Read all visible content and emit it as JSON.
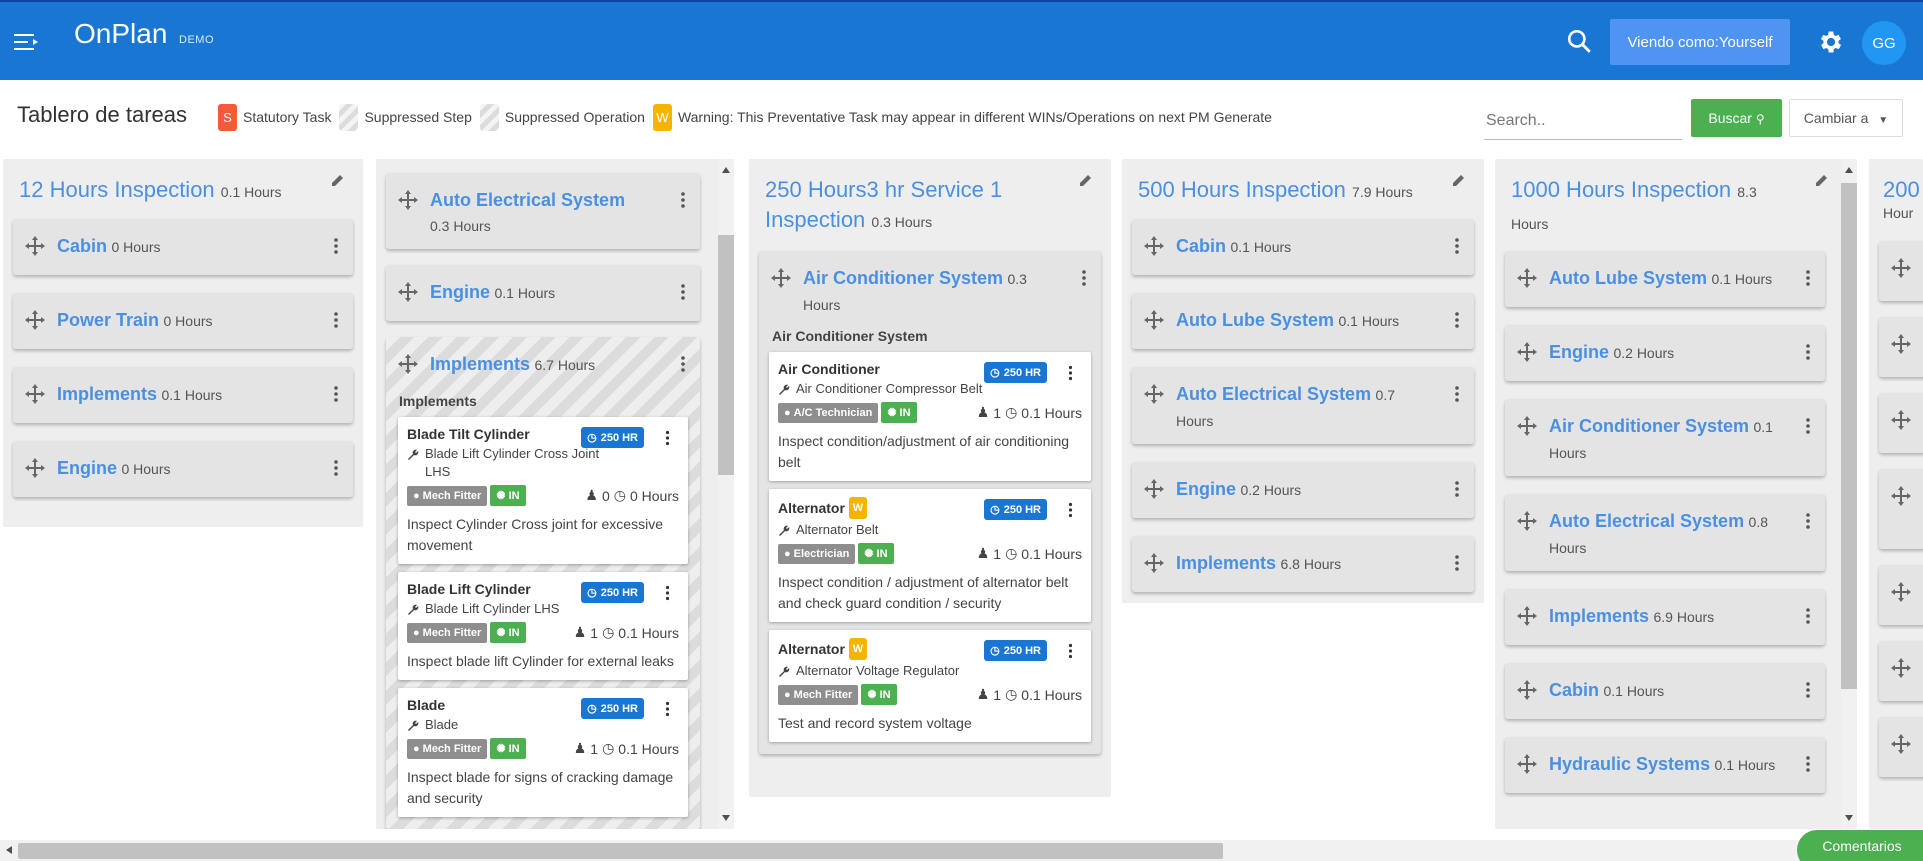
{
  "header": {
    "brand": "OnPlan",
    "brand_sub": "DEMO",
    "viewing_label": "Viendo como:Yourself",
    "avatar_initials": "GG"
  },
  "toolbar": {
    "title": "Tablero de tareas",
    "legend": [
      {
        "badge": "S",
        "label": "Statutory Task"
      },
      {
        "badge": "",
        "label": "Suppressed Step"
      },
      {
        "badge": "",
        "label": "Suppressed Operation"
      },
      {
        "badge": "W",
        "label": "Warning: This Preventative Task may appear in different WINs/Operations on next PM Generate"
      }
    ],
    "search_placeholder": "Search..",
    "search_button": "Buscar",
    "change_button": "Cambiar a"
  },
  "columns": [
    {
      "title": "12 Hours Inspection",
      "hours": "0.1 Hours",
      "systems": [
        {
          "name": "Cabin",
          "hours": "0 Hours"
        },
        {
          "name": "Power Train",
          "hours": "0 Hours"
        },
        {
          "name": "Implements",
          "hours": "0.1 Hours"
        },
        {
          "name": "Engine",
          "hours": "0 Hours"
        }
      ]
    },
    {
      "systems": [
        {
          "name": "Auto Electrical System",
          "hours": "0.3 Hours"
        },
        {
          "name": "Engine",
          "hours": "0.1 Hours"
        },
        {
          "name": "Implements",
          "hours": "6.7 Hours",
          "group": "Implements",
          "tasks": [
            {
              "name": "Blade Tilt Cylinder",
              "badge": "250 HR",
              "component": "Blade Lift Cylinder Cross Joint LHS",
              "trade": "Mech Fitter",
              "in": "IN",
              "qty": "0",
              "hours": "0 Hours",
              "desc": "Inspect Cylinder Cross joint for excessive movement"
            },
            {
              "name": "Blade Lift Cylinder",
              "badge": "250 HR",
              "component": "Blade Lift Cylinder LHS",
              "trade": "Mech Fitter",
              "in": "IN",
              "qty": "1",
              "hours": "0.1 Hours",
              "desc": "Inspect blade lift Cylinder for external leaks"
            },
            {
              "name": "Blade",
              "badge": "250 HR",
              "component": "Blade",
              "trade": "Mech Fitter",
              "in": "IN",
              "qty": "1",
              "hours": "0.1 Hours",
              "desc": "Inspect blade for signs of cracking damage and security"
            }
          ]
        }
      ]
    },
    {
      "title": "250 Hours3 hr Service 1 Inspection",
      "hours": "0.3 Hours",
      "systems": [
        {
          "name": "Air Conditioner System",
          "hours": "0.3 Hours",
          "group": "Air Conditioner System",
          "tasks": [
            {
              "name": "Air Conditioner",
              "badge": "250 HR",
              "component": "Air Conditioner Compressor Belt",
              "trade": "A/C Technician",
              "in": "IN",
              "qty": "1",
              "hours": "0.1 Hours",
              "desc": "Inspect condition/adjustment of air conditioning belt"
            },
            {
              "name": "Alternator",
              "warn": "W",
              "badge": "250 HR",
              "component": "Alternator Belt",
              "trade": "Electrician",
              "in": "IN",
              "qty": "1",
              "hours": "0.1 Hours",
              "desc": "Inspect condition / adjustment of alternator belt and check guard condition / security"
            },
            {
              "name": "Alternator",
              "warn": "W",
              "badge": "250 HR",
              "component": "Alternator Voltage Regulator",
              "trade": "Mech Fitter",
              "in": "IN",
              "qty": "1",
              "hours": "0.1 Hours",
              "desc": "Test and record system voltage"
            }
          ]
        }
      ]
    },
    {
      "title": "500 Hours Inspection",
      "hours": "7.9 Hours",
      "systems": [
        {
          "name": "Cabin",
          "hours": "0.1 Hours"
        },
        {
          "name": "Auto Lube System",
          "hours": "0.1 Hours"
        },
        {
          "name": "Auto Electrical System",
          "hours": "0.7 Hours"
        },
        {
          "name": "Engine",
          "hours": "0.2 Hours"
        },
        {
          "name": "Implements",
          "hours": "6.8 Hours"
        }
      ]
    },
    {
      "title": "1000 Hours Inspection",
      "hours": "8.3 Hours",
      "systems": [
        {
          "name": "Auto Lube System",
          "hours": "0.1 Hours"
        },
        {
          "name": "Engine",
          "hours": "0.2 Hours"
        },
        {
          "name": "Air Conditioner System",
          "hours": "0.1 Hours"
        },
        {
          "name": "Auto Electrical System",
          "hours": "0.8 Hours"
        },
        {
          "name": "Implements",
          "hours": "6.9 Hours"
        },
        {
          "name": "Cabin",
          "hours": "0.1 Hours"
        },
        {
          "name": "Hydraulic Systems",
          "hours": "0.1 Hours"
        }
      ]
    },
    {
      "title": "200",
      "hours": "Hour"
    }
  ],
  "footer": {
    "comments_button": "Comentarios"
  },
  "colors": {
    "primary": "#1976d2",
    "link": "#4a90e2",
    "success": "#4caf50",
    "warning": "#f5b400",
    "statutory": "#f25a38"
  }
}
